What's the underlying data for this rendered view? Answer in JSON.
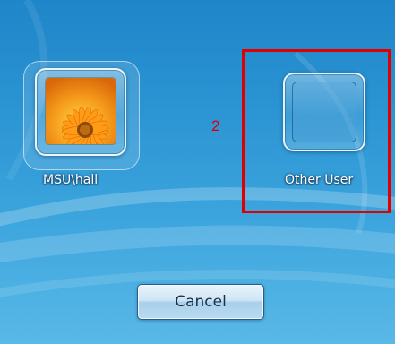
{
  "users": [
    {
      "label": "MSU\\hall",
      "picture": "orange-flower-icon"
    },
    {
      "label": "Other User",
      "picture": "blank-user-icon"
    }
  ],
  "annotation": {
    "step": "2",
    "color": "#e00000"
  },
  "cancel_button": {
    "label": "Cancel"
  }
}
